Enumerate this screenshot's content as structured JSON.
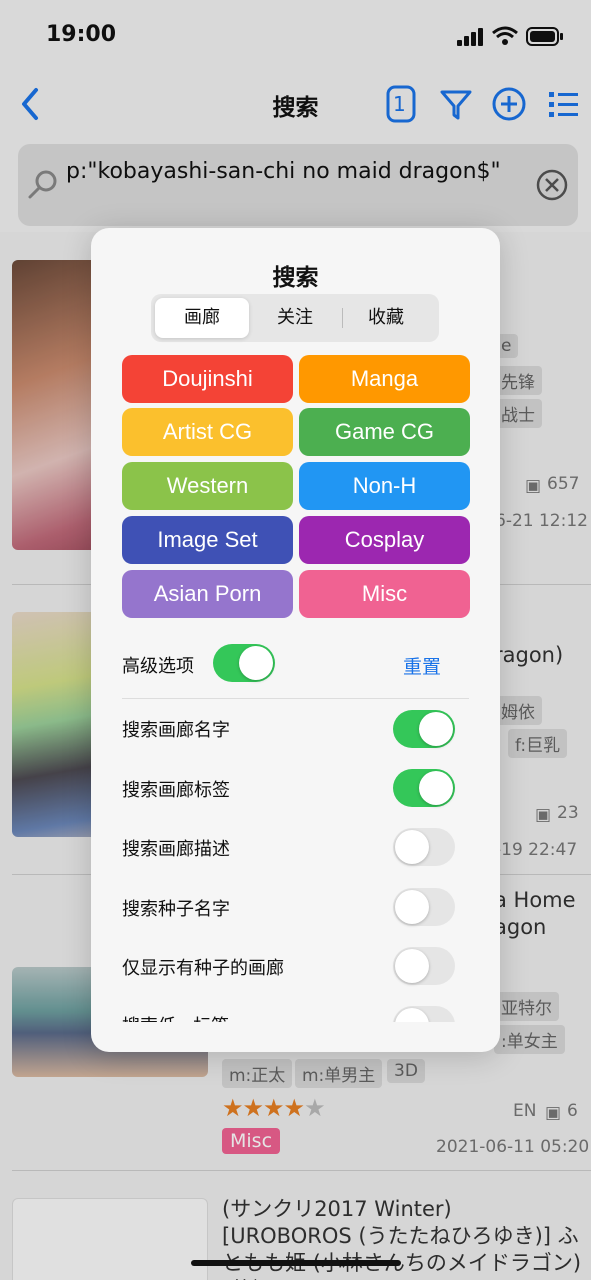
{
  "status": {
    "time": "19:00"
  },
  "nav": {
    "title": "搜索",
    "tab_count": "1"
  },
  "search": {
    "query": "p:\"kobayashi-san-chi no maid dragon$\""
  },
  "background": {
    "rows": [
      {
        "tags": [
          "e",
          "先锋",
          "战士"
        ],
        "count": "657",
        "date": "6-21 12:12"
      },
      {
        "title": "ragon)",
        "tags": [
          "姆依",
          "f:巨乳"
        ],
        "count": "23",
        "date": "-19 22:47"
      },
      {
        "title": "a Home\nagon",
        "tags": [
          "亚特尔",
          ":单女主",
          "m:正太",
          "m:单男主",
          "3D"
        ],
        "lang": "EN",
        "count": "6",
        "category": "Misc",
        "date": "2021-06-11 05:20"
      },
      {
        "title": "(サンクリ2017 Winter) [UROBOROS (うたたねひろゆき)] ふともも姫 (小林さんちのメイドラゴン) [英訳]"
      }
    ]
  },
  "popover": {
    "title": "搜索",
    "segments": [
      "画廊",
      "关注",
      "收藏"
    ],
    "categories": [
      {
        "label": "Doujinshi",
        "color": "#f44336"
      },
      {
        "label": "Manga",
        "color": "#ff9800"
      },
      {
        "label": "Artist CG",
        "color": "#fbc02d"
      },
      {
        "label": "Game CG",
        "color": "#4caf50"
      },
      {
        "label": "Western",
        "color": "#8bc34a"
      },
      {
        "label": "Non-H",
        "color": "#2196f3"
      },
      {
        "label": "Image Set",
        "color": "#3f51b5"
      },
      {
        "label": "Cosplay",
        "color": "#9c27b0"
      },
      {
        "label": "Asian Porn",
        "color": "#9575cd"
      },
      {
        "label": "Misc",
        "color": "#f06292"
      }
    ],
    "advanced_label": "高级选项",
    "reset_label": "重置",
    "options": [
      {
        "label": "搜索画廊名字",
        "on": true
      },
      {
        "label": "搜索画廊标签",
        "on": true
      },
      {
        "label": "搜索画廊描述",
        "on": false
      },
      {
        "label": "搜索种子名字",
        "on": false
      },
      {
        "label": "仅显示有种子的画廊",
        "on": false
      },
      {
        "label": "搜索低...标签",
        "on": false
      }
    ]
  },
  "colors": {
    "accent": "#1a73e8",
    "toggle_on": "#34c759"
  }
}
